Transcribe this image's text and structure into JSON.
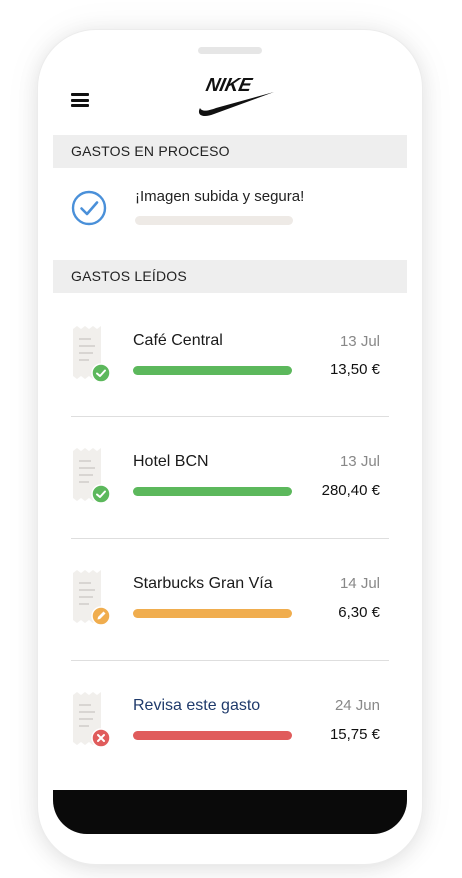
{
  "brand": {
    "logo_text": "NIKE"
  },
  "sections": {
    "processing_title": "GASTOS EN PROCESO",
    "read_title": "GASTOS LEÍDOS"
  },
  "processing": {
    "message": "¡Imagen subida y segura!",
    "progress": 0,
    "icon": "check-circle-icon"
  },
  "expenses": [
    {
      "name": "Café Central",
      "date": "13 Jul",
      "amount": "13,50 €",
      "status": "approved",
      "status_icon": "check-icon",
      "color": "#5cb85c"
    },
    {
      "name": "Hotel BCN",
      "date": "13 Jul",
      "amount": "280,40 €",
      "status": "approved",
      "status_icon": "check-icon",
      "color": "#5cb85c"
    },
    {
      "name": "Starbucks Gran Vía",
      "date": "14 Jul",
      "amount": "6,30 €",
      "status": "pending",
      "status_icon": "pencil-icon",
      "color": "#f0ad4e"
    },
    {
      "name": "Revisa este gasto",
      "date": "24 Jun",
      "amount": "15,75 €",
      "status": "rejected",
      "status_icon": "x-icon",
      "color": "#e05c5c"
    }
  ],
  "colors": {
    "accent_blue": "#4a90d9",
    "approved": "#5cb85c",
    "pending": "#f0ad4e",
    "rejected": "#e05c5c",
    "alert_text": "#1f3a6b"
  }
}
